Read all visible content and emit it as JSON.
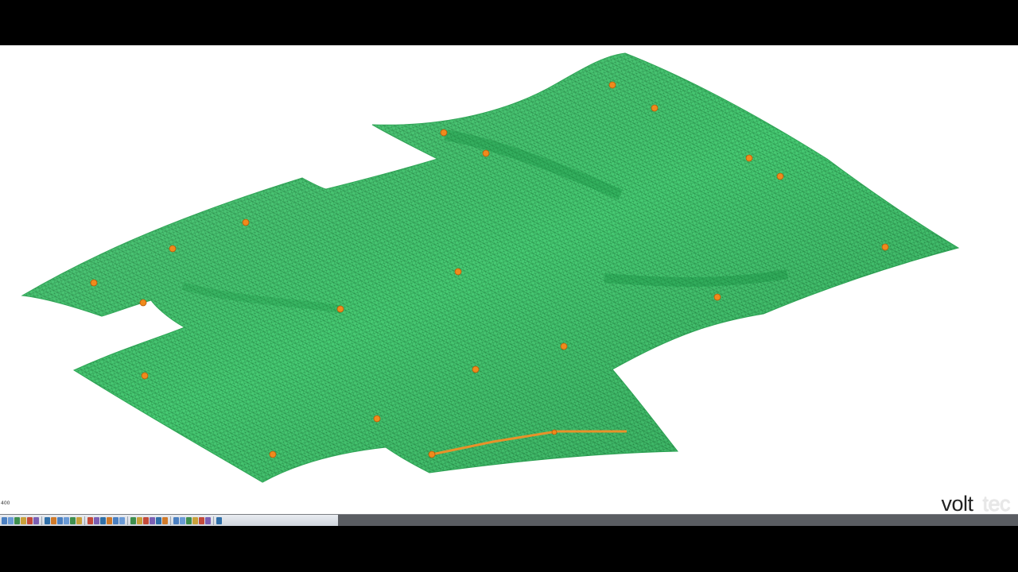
{
  "viewport": {
    "scale_readout": "400",
    "colors": {
      "background": "#ffffff",
      "surface_fill": "#3ec46a",
      "mesh_line": "#1f7a3d",
      "marker": "#f08a1c",
      "cable": "#e8922a"
    }
  },
  "brand": {
    "part1": "volt",
    "part2": "tec"
  },
  "toolbar": {
    "icons": [
      "zoom-extents-icon",
      "zoom-in-icon",
      "zoom-out-icon",
      "pan-icon",
      "rotate-icon",
      "fit-icon",
      "select-icon",
      "filter-icon",
      "measure-icon",
      "ruler-icon",
      "layer-icon",
      "grid-icon",
      "mesh-icon",
      "node-icon",
      "elevation-icon",
      "snap-icon",
      "render-icon",
      "wireframe-icon",
      "shade-icon",
      "light-icon",
      "pointer-icon",
      "text-icon",
      "dimension-icon",
      "pencil-icon",
      "marker-icon",
      "camera-icon",
      "chart-icon",
      "table-icon",
      "refresh-icon",
      "undo-icon",
      "export-icon"
    ]
  }
}
